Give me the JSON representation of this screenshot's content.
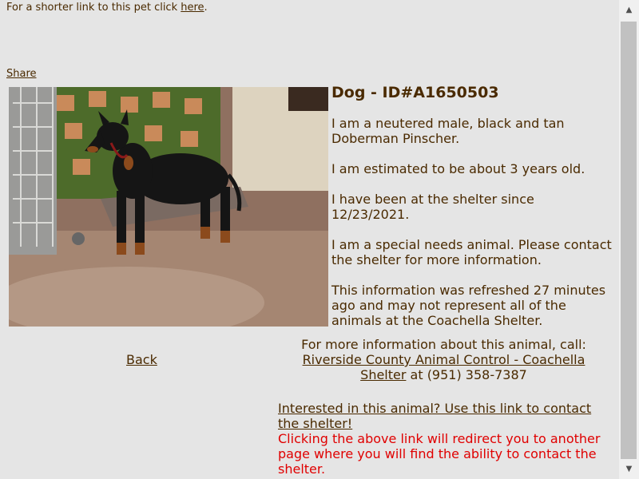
{
  "short_link": {
    "text": "For a shorter link to this pet click ",
    "link_text": "here",
    "suffix": "."
  },
  "share_label": "Share",
  "pet": {
    "title": "Dog - ID#A1650503",
    "description": "I am a neutered male, black and tan Doberman Pinscher.",
    "age": "I am estimated to be about 3 years old.",
    "since": "I have been at the shelter since 12/23/2021.",
    "special_needs": "I am a special needs animal. Please contact the shelter for more information.",
    "refresh": "This information was refreshed 27 minutes ago and may not represent all of the animals at the Coachella Shelter."
  },
  "back_label": "Back",
  "more_info": {
    "prefix": "For more information about this animal, call:",
    "shelter_link": "Riverside County Animal Control - Coachella Shelter",
    "phone": " at (951) 358-7387"
  },
  "contact": {
    "link": "Interested in this animal? Use this link to contact the shelter!",
    "warning": "Clicking the above link will redirect you to another page where you will find the ability to contact the shelter."
  },
  "scrollbar": {
    "up_icon": "▲",
    "down_icon": "▼"
  }
}
